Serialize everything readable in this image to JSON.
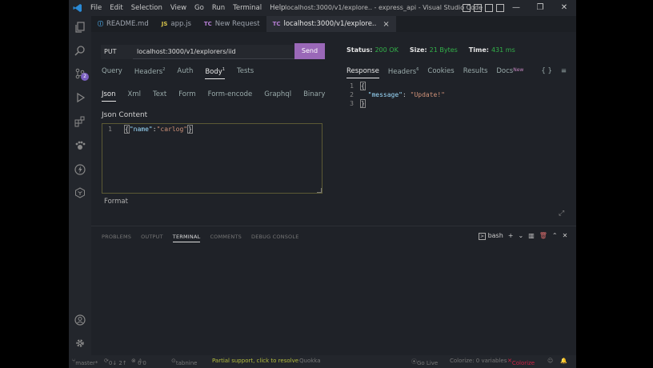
{
  "window": {
    "title": "localhost:3000/v1/explore.. - express_api - Visual Studio Code",
    "menu": [
      "File",
      "Edit",
      "Selection",
      "View",
      "Go",
      "Run",
      "Terminal",
      "Help"
    ],
    "controls": [
      "—",
      "❐",
      "✕"
    ]
  },
  "tabs": [
    {
      "label": "README.md",
      "icon": "info-icon",
      "icon_text": "ⓘ"
    },
    {
      "label": "app.js",
      "icon": "js-icon",
      "icon_text": "JS"
    },
    {
      "label": "New Request",
      "icon": "thunder-client-icon",
      "icon_text": "TC"
    },
    {
      "label": "localhost:3000/v1/explore..",
      "icon": "thunder-client-icon",
      "icon_text": "TC",
      "active": true,
      "close": "×"
    }
  ],
  "request": {
    "method": "PUT",
    "url": "localhost:3000/v1/explorers/iid",
    "send_label": "Send"
  },
  "response_status": {
    "status_label": "Status:",
    "status_value": "200 OK",
    "size_label": "Size:",
    "size_value": "21 Bytes",
    "time_label": "Time:",
    "time_value": "431 ms"
  },
  "request_nav": {
    "query": "Query",
    "headers": "Headers",
    "headers_count": "2",
    "auth": "Auth",
    "body": "Body",
    "body_count": "1",
    "tests": "Tests"
  },
  "body_nav": [
    "Json",
    "Xml",
    "Text",
    "Form",
    "Form-encode",
    "Graphql",
    "Binary"
  ],
  "json_content": {
    "label": "Json Content",
    "line_no": "1",
    "open_brace": "{",
    "key": "\"name\"",
    "colon": ":",
    "value": "\"carlog\"",
    "close_brace": "}",
    "format_label": "Format"
  },
  "response_nav": {
    "response": "Response",
    "headers": "Headers",
    "headers_count": "6",
    "cookies": "Cookies",
    "results": "Results",
    "docs": "Docs",
    "docs_badge": "New",
    "braces": "{ }",
    "menu": "≡"
  },
  "response_body": {
    "line1_no": "1",
    "line1": "{",
    "line2_no": "2",
    "line2_key": "\"message\"",
    "line2_colon": ": ",
    "line2_value": "\"Update!\"",
    "line3_no": "3",
    "line3": "}"
  },
  "panel": {
    "tabs": [
      "PROBLEMS",
      "OUTPUT",
      "TERMINAL",
      "COMMENTS",
      "DEBUG CONSOLE"
    ],
    "active_tab": "TERMINAL",
    "shell": "bash",
    "plus": "+",
    "chevron": "⌄",
    "close": "✕"
  },
  "statusbar": {
    "branch": "master*",
    "sync": "0↓ 2↑",
    "errors": "0",
    "warnings": "0",
    "tabnine": "tabnine",
    "partial_support": "Partial support, click to resolve",
    "quokka": "Quokka",
    "go_live": "Go Live",
    "colorize_vars": "Colorize: 0 variables",
    "colorize": "Colorize"
  },
  "colors": {
    "send_button": "#9a68b8",
    "status_ok": "#33b24a",
    "badge": "#7a5fc0",
    "editor_bg": "#1f2228"
  }
}
